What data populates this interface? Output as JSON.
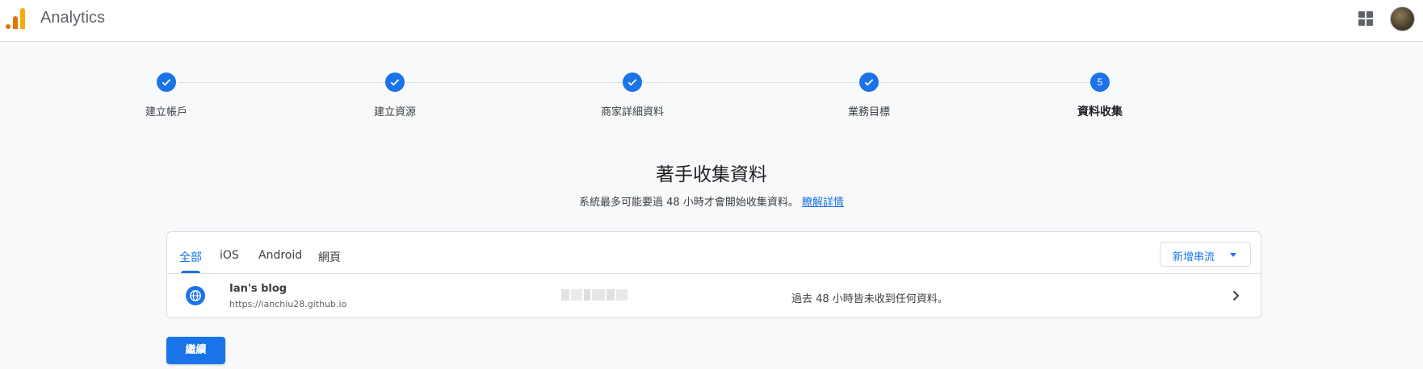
{
  "app": {
    "title": "Analytics"
  },
  "header": {
    "apps_icon": "apps-grid-icon",
    "avatar": "account-avatar"
  },
  "stepper": {
    "steps": [
      {
        "label": "建立帳戶",
        "state": "done"
      },
      {
        "label": "建立資源",
        "state": "done"
      },
      {
        "label": "商家詳細資料",
        "state": "done"
      },
      {
        "label": "業務目標",
        "state": "done"
      },
      {
        "label": "資料收集",
        "state": "active",
        "number": "5"
      }
    ]
  },
  "main": {
    "heading": "著手收集資料",
    "subheading": "系統最多可能要過 48 小時才會開始收集資料。",
    "learn_more": "瞭解詳情"
  },
  "card": {
    "tabs": [
      {
        "label": "全部",
        "active": true
      },
      {
        "label": "iOS",
        "active": false
      },
      {
        "label": "Android",
        "active": false
      },
      {
        "label": "網頁",
        "active": false
      }
    ],
    "add_stream_label": "新增串流",
    "streams": [
      {
        "icon": "globe-icon",
        "name": "Ian's blog",
        "url": "https://ianchiu28.github.io",
        "status": "過去 48 小時皆未收到任何資料。"
      }
    ]
  },
  "actions": {
    "continue_label": "繼續"
  },
  "colors": {
    "accent": "#1a73e8",
    "logo_orange": "#e37400",
    "logo_yellow": "#f9ab00"
  }
}
